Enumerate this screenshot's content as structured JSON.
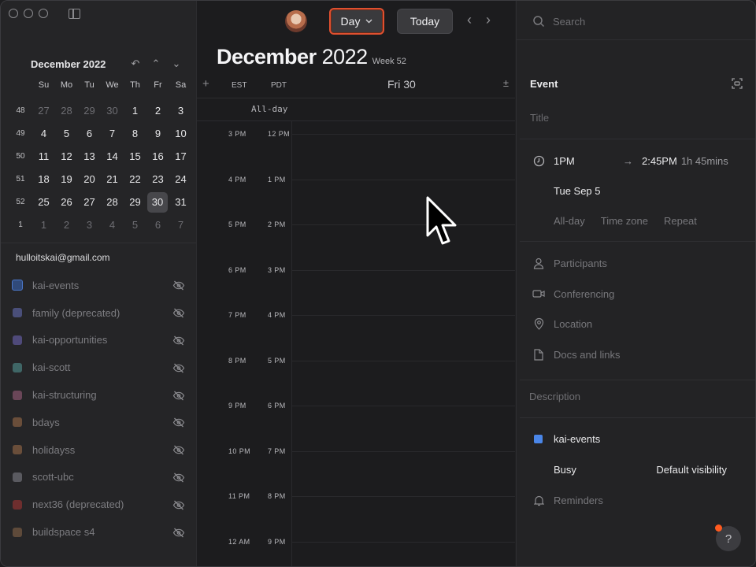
{
  "app": {
    "window_controls": [
      "close",
      "minimize",
      "zoom"
    ]
  },
  "mini_calendar": {
    "month_label": "December 2022",
    "dow": [
      "Su",
      "Mo",
      "Tu",
      "We",
      "Th",
      "Fr",
      "Sa"
    ],
    "weeks": [
      {
        "num": "48",
        "days": [
          {
            "d": "27",
            "dim": true
          },
          {
            "d": "28",
            "dim": true
          },
          {
            "d": "29",
            "dim": true
          },
          {
            "d": "30",
            "dim": true
          },
          {
            "d": "1"
          },
          {
            "d": "2"
          },
          {
            "d": "3"
          }
        ]
      },
      {
        "num": "49",
        "days": [
          {
            "d": "4"
          },
          {
            "d": "5"
          },
          {
            "d": "6"
          },
          {
            "d": "7"
          },
          {
            "d": "8"
          },
          {
            "d": "9"
          },
          {
            "d": "10"
          }
        ]
      },
      {
        "num": "50",
        "days": [
          {
            "d": "11"
          },
          {
            "d": "12"
          },
          {
            "d": "13"
          },
          {
            "d": "14"
          },
          {
            "d": "15"
          },
          {
            "d": "16"
          },
          {
            "d": "17"
          }
        ]
      },
      {
        "num": "51",
        "days": [
          {
            "d": "18"
          },
          {
            "d": "19"
          },
          {
            "d": "20"
          },
          {
            "d": "21"
          },
          {
            "d": "22"
          },
          {
            "d": "23"
          },
          {
            "d": "24"
          }
        ]
      },
      {
        "num": "52",
        "days": [
          {
            "d": "25"
          },
          {
            "d": "26"
          },
          {
            "d": "27"
          },
          {
            "d": "28"
          },
          {
            "d": "29"
          },
          {
            "d": "30",
            "sel": true
          },
          {
            "d": "31"
          }
        ]
      },
      {
        "num": "1",
        "days": [
          {
            "d": "1",
            "dim": true
          },
          {
            "d": "2",
            "dim": true
          },
          {
            "d": "3",
            "dim": true
          },
          {
            "d": "4",
            "dim": true
          },
          {
            "d": "5",
            "dim": true
          },
          {
            "d": "6",
            "dim": true
          },
          {
            "d": "7",
            "dim": true
          }
        ]
      }
    ]
  },
  "account": "hulloitskai@gmail.com",
  "calendars": [
    {
      "name": "kai-events",
      "color": "#304a7a",
      "active": true
    },
    {
      "name": "family (deprecated)",
      "color": "#4a4f7a"
    },
    {
      "name": "kai-opportunities",
      "color": "#4f4a7a"
    },
    {
      "name": "kai-scott",
      "color": "#3f6666"
    },
    {
      "name": "kai-structuring",
      "color": "#6a4658"
    },
    {
      "name": "bdays",
      "color": "#6a4e3a"
    },
    {
      "name": "holidayss",
      "color": "#6a4e3a"
    },
    {
      "name": "scott-ubc",
      "color": "#5a5a60"
    },
    {
      "name": "next36 (deprecated)",
      "color": "#6e2e2e"
    },
    {
      "name": "buildspace s4",
      "color": "#5e4a3a"
    }
  ],
  "toolbar": {
    "view_label": "Day",
    "today_label": "Today"
  },
  "main": {
    "month": "December",
    "year": "2022",
    "week": "Week 52",
    "tz1": "EST",
    "tz2": "PDT",
    "day_label": "Fri 30",
    "allday": "All-day",
    "hours": [
      {
        "a": "3 PM",
        "b": "12 PM"
      },
      {
        "a": "4 PM",
        "b": "1 PM"
      },
      {
        "a": "5 PM",
        "b": "2 PM"
      },
      {
        "a": "6 PM",
        "b": "3 PM"
      },
      {
        "a": "7 PM",
        "b": "4 PM"
      },
      {
        "a": "8 PM",
        "b": "5 PM"
      },
      {
        "a": "9 PM",
        "b": "6 PM"
      },
      {
        "a": "10 PM",
        "b": "7 PM"
      },
      {
        "a": "11 PM",
        "b": "8 PM"
      },
      {
        "a": "12 AM",
        "b": "9 PM"
      }
    ]
  },
  "panel": {
    "search_placeholder": "Search",
    "heading": "Event",
    "title_placeholder": "Title",
    "start": "1PM",
    "end": "2:45PM",
    "duration": "1h 45mins",
    "date": "Tue Sep 5",
    "allday": "All-day",
    "timezone": "Time zone",
    "repeat": "Repeat",
    "participants": "Participants",
    "conferencing": "Conferencing",
    "location": "Location",
    "docs": "Docs and links",
    "description": "Description",
    "calendar": "kai-events",
    "calendar_color": "#4a86e8",
    "busy": "Busy",
    "visibility": "Default visibility",
    "reminders": "Reminders",
    "help": "?"
  }
}
